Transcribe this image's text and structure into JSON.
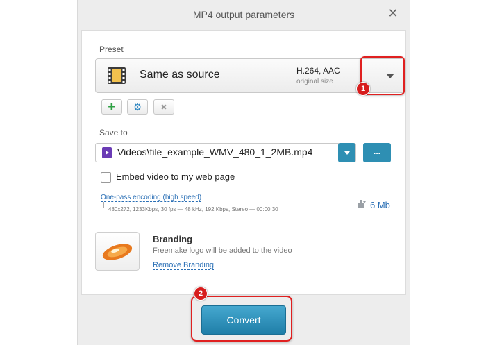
{
  "window": {
    "title": "MP4 output parameters",
    "close_glyph": "✕"
  },
  "preset": {
    "label": "Preset",
    "name": "Same as source",
    "codec": "H.264, AAC",
    "size_note": "original size",
    "icon": "film-strip-icon"
  },
  "preset_actions": [
    {
      "name": "add",
      "glyph": "✚",
      "color": "#2ea043",
      "icon": "plus-icon"
    },
    {
      "name": "edit",
      "glyph": "⚙",
      "color": "#2e86c1",
      "icon": "gear-icon"
    },
    {
      "name": "delete",
      "glyph": "✖",
      "color": "#999999",
      "icon": "delete-icon"
    }
  ],
  "save": {
    "label": "Save to",
    "path": "Videos\\file_example_WMV_480_1_2MB.mp4",
    "browse_label": "..."
  },
  "embed": {
    "label": "Embed video to my web page",
    "checked": false
  },
  "encoding": {
    "mode": "One-pass encoding (high speed)",
    "details": "480x272, 1233Kbps, 30 fps — 48 kHz, 192 Kbps, Stereo — 00:00:30",
    "size": "6 Mb"
  },
  "branding": {
    "title": "Branding",
    "description": "Freemake logo will be added to the video",
    "link": "Remove Branding"
  },
  "convert_label": "Convert",
  "annotations": {
    "badge1": "1",
    "badge2": "2",
    "highlight_color": "#e02020"
  },
  "colors": {
    "accent": "#2e8fb3",
    "link": "#2a6fb5"
  }
}
